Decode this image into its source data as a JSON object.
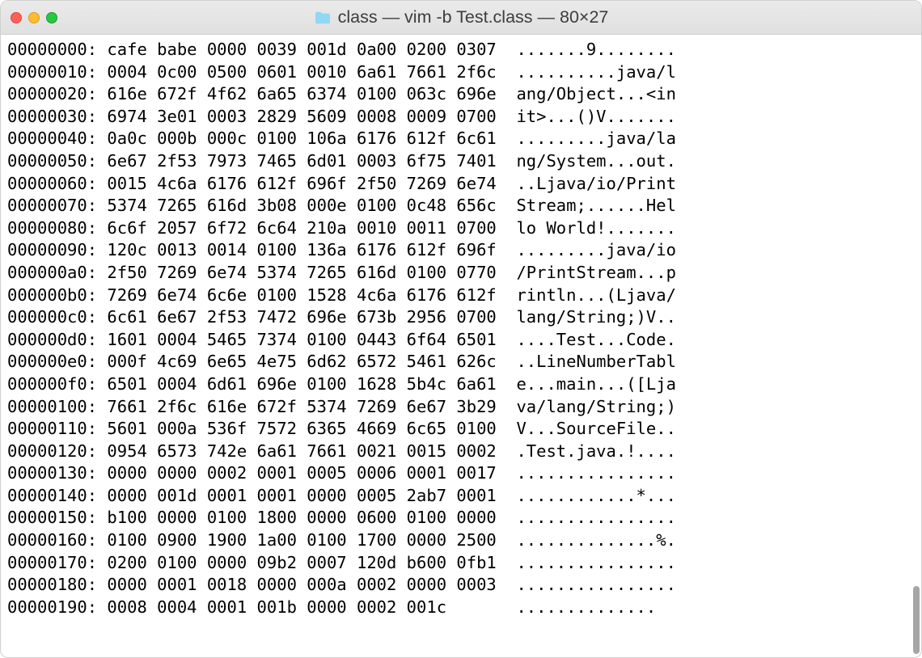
{
  "window": {
    "title": "class — vim -b Test.class — 80×27"
  },
  "traffic": {
    "close": "close",
    "min": "minimize",
    "max": "maximize"
  },
  "hexdump": {
    "lines": [
      {
        "offset": "00000000:",
        "hex": "cafe babe 0000 0039 001d 0a00 0200 0307",
        "ascii": ".......9........"
      },
      {
        "offset": "00000010:",
        "hex": "0004 0c00 0500 0601 0010 6a61 7661 2f6c",
        "ascii": "..........java/l"
      },
      {
        "offset": "00000020:",
        "hex": "616e 672f 4f62 6a65 6374 0100 063c 696e",
        "ascii": "ang/Object...<in"
      },
      {
        "offset": "00000030:",
        "hex": "6974 3e01 0003 2829 5609 0008 0009 0700",
        "ascii": "it>...()V......."
      },
      {
        "offset": "00000040:",
        "hex": "0a0c 000b 000c 0100 106a 6176 612f 6c61",
        "ascii": ".........java/la"
      },
      {
        "offset": "00000050:",
        "hex": "6e67 2f53 7973 7465 6d01 0003 6f75 7401",
        "ascii": "ng/System...out."
      },
      {
        "offset": "00000060:",
        "hex": "0015 4c6a 6176 612f 696f 2f50 7269 6e74",
        "ascii": "..Ljava/io/Print"
      },
      {
        "offset": "00000070:",
        "hex": "5374 7265 616d 3b08 000e 0100 0c48 656c",
        "ascii": "Stream;......Hel"
      },
      {
        "offset": "00000080:",
        "hex": "6c6f 2057 6f72 6c64 210a 0010 0011 0700",
        "ascii": "lo World!......."
      },
      {
        "offset": "00000090:",
        "hex": "120c 0013 0014 0100 136a 6176 612f 696f",
        "ascii": ".........java/io"
      },
      {
        "offset": "000000a0:",
        "hex": "2f50 7269 6e74 5374 7265 616d 0100 0770",
        "ascii": "/PrintStream...p"
      },
      {
        "offset": "000000b0:",
        "hex": "7269 6e74 6c6e 0100 1528 4c6a 6176 612f",
        "ascii": "rintln...(Ljava/"
      },
      {
        "offset": "000000c0:",
        "hex": "6c61 6e67 2f53 7472 696e 673b 2956 0700",
        "ascii": "lang/String;)V.."
      },
      {
        "offset": "000000d0:",
        "hex": "1601 0004 5465 7374 0100 0443 6f64 6501",
        "ascii": "....Test...Code."
      },
      {
        "offset": "000000e0:",
        "hex": "000f 4c69 6e65 4e75 6d62 6572 5461 626c",
        "ascii": "..LineNumberTabl"
      },
      {
        "offset": "000000f0:",
        "hex": "6501 0004 6d61 696e 0100 1628 5b4c 6a61",
        "ascii": "e...main...([Lja"
      },
      {
        "offset": "00000100:",
        "hex": "7661 2f6c 616e 672f 5374 7269 6e67 3b29",
        "ascii": "va/lang/String;)"
      },
      {
        "offset": "00000110:",
        "hex": "5601 000a 536f 7572 6365 4669 6c65 0100",
        "ascii": "V...SourceFile.."
      },
      {
        "offset": "00000120:",
        "hex": "0954 6573 742e 6a61 7661 0021 0015 0002",
        "ascii": ".Test.java.!...."
      },
      {
        "offset": "00000130:",
        "hex": "0000 0000 0002 0001 0005 0006 0001 0017",
        "ascii": "................"
      },
      {
        "offset": "00000140:",
        "hex": "0000 001d 0001 0001 0000 0005 2ab7 0001",
        "ascii": "............*..."
      },
      {
        "offset": "00000150:",
        "hex": "b100 0000 0100 1800 0000 0600 0100 0000",
        "ascii": "................"
      },
      {
        "offset": "00000160:",
        "hex": "0100 0900 1900 1a00 0100 1700 0000 2500",
        "ascii": "..............%."
      },
      {
        "offset": "00000170:",
        "hex": "0200 0100 0000 09b2 0007 120d b600 0fb1",
        "ascii": "................"
      },
      {
        "offset": "00000180:",
        "hex": "0000 0001 0018 0000 000a 0002 0000 0003",
        "ascii": "................"
      },
      {
        "offset": "00000190:",
        "hex": "0008 0004 0001 001b 0000 0002 001c",
        "ascii": ".............."
      }
    ]
  }
}
